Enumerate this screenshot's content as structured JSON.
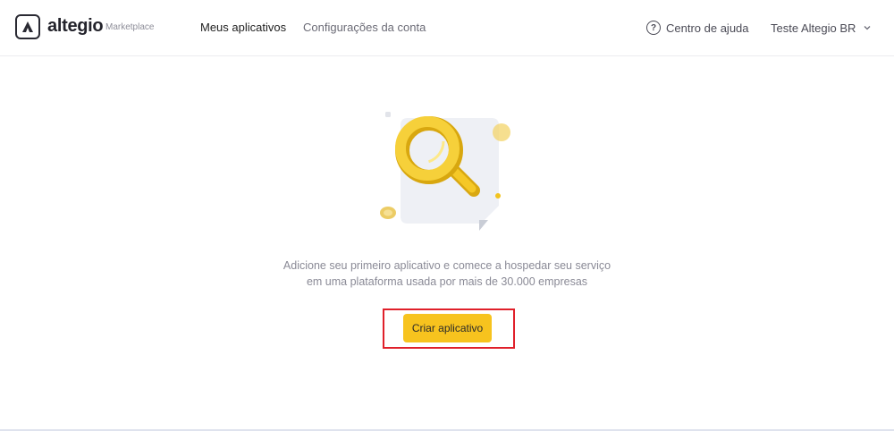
{
  "header": {
    "brand": "altegio",
    "brand_sub": "Marketplace",
    "nav": [
      {
        "label": "Meus aplicativos",
        "active": true
      },
      {
        "label": "Configurações da conta",
        "active": false
      }
    ],
    "help_label": "Centro de ajuda",
    "help_icon": "question-circle-icon",
    "account_name": "Teste Altegio BR",
    "account_icon": "chevron-down-icon"
  },
  "empty_state": {
    "illustration": "magnifier-icon",
    "line1": "Adicione seu primeiro aplicativo e comece a hospedar seu serviço",
    "line2": "em uma plataforma usada por mais de 30.000 empresas",
    "button_label": "Criar aplicativo"
  },
  "colors": {
    "accent": "#f7c31e",
    "highlight": "#e0202a"
  }
}
